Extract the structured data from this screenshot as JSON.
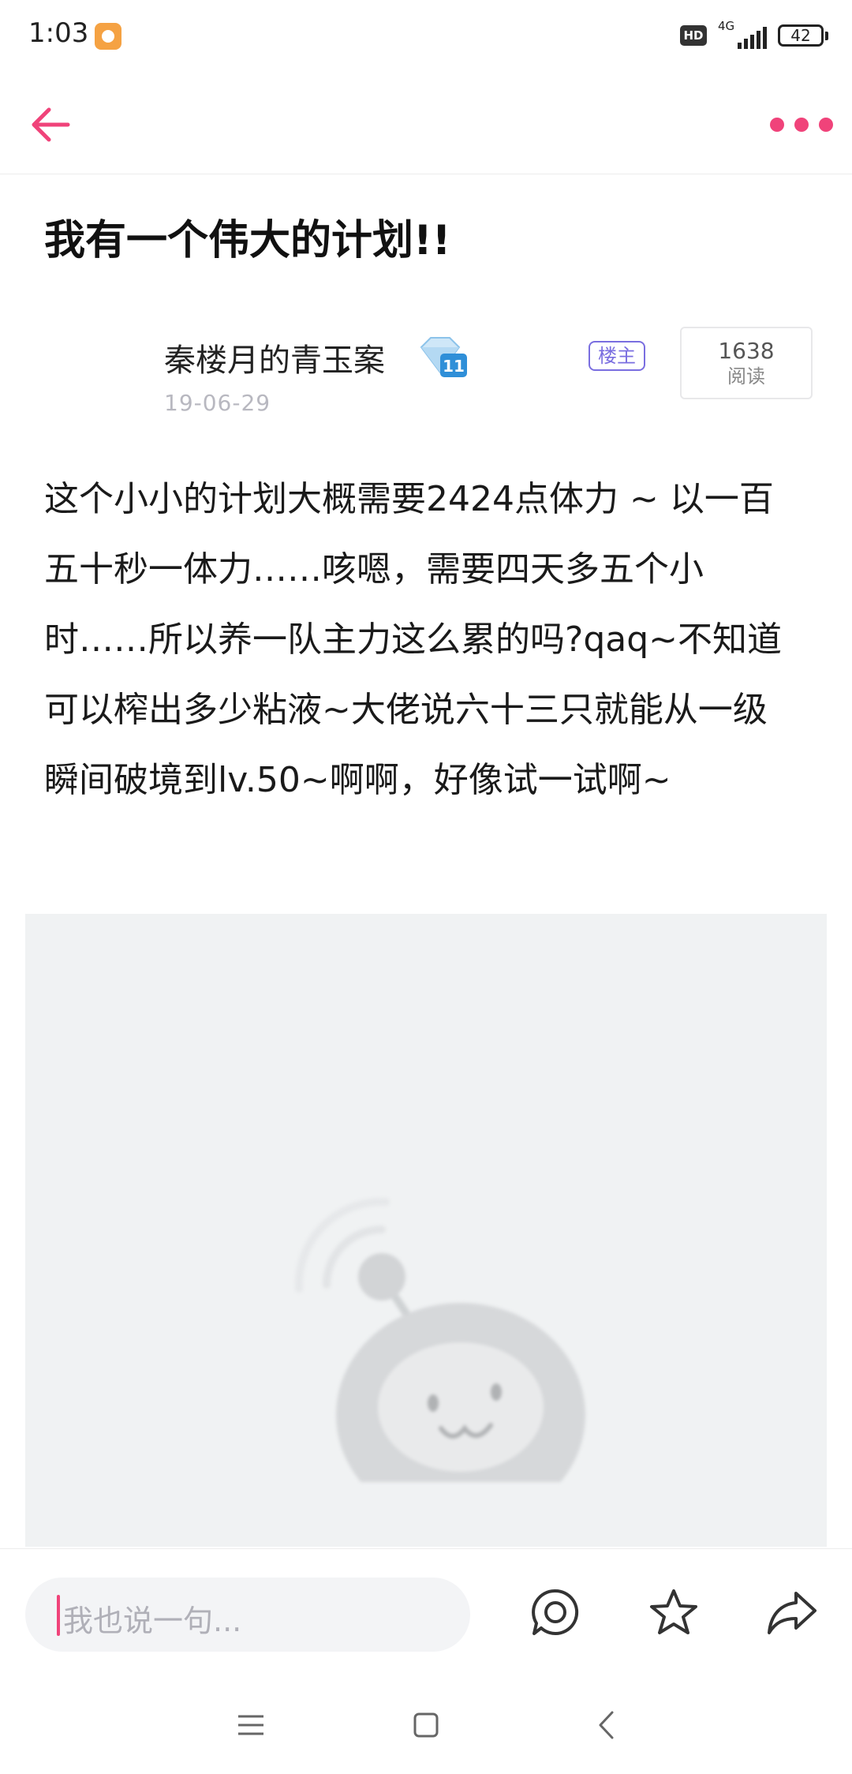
{
  "status_bar": {
    "time": "1:03",
    "hd": "HD",
    "network": "4G",
    "battery": "42"
  },
  "nav": {
    "back_icon": "arrow-left-icon",
    "more_icon": "more-dots-icon",
    "accent_color": "#f0437a"
  },
  "post": {
    "title": "我有一个伟大的计划!!",
    "author": {
      "name": "秦楼月的青玉案",
      "level": "11",
      "date": "19-06-29",
      "owner_badge": "楼主"
    },
    "reads": {
      "count": "1638",
      "label": "阅读"
    },
    "body": "这个小小的计划大概需要2424点体力 ~ 以一百五十秒一体力……咳嗯，需要四天多五个小时……所以养一队主力这么累的吗?qaq~不知道可以榨出多少粘液~大佬说六十三只就能从一级瞬间破境到lv.50~啊啊，好像试一试啊~"
  },
  "action_bar": {
    "comment_placeholder": "我也说一句...",
    "icons": [
      "comment-icon",
      "star-icon",
      "share-icon"
    ]
  },
  "system_nav": [
    "menu-icon",
    "home-icon",
    "back-icon"
  ]
}
